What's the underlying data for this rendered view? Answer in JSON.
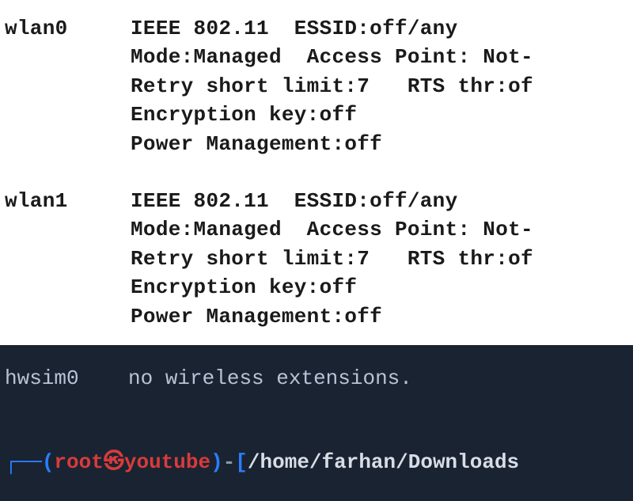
{
  "interfaces": [
    {
      "name": "wlan0",
      "lines": [
        "wlan0     IEEE 802.11  ESSID:off/any",
        "          Mode:Managed  Access Point: Not-",
        "          Retry short limit:7   RTS thr:of",
        "          Encryption key:off",
        "          Power Management:off"
      ]
    },
    {
      "name": "wlan1",
      "lines": [
        "wlan1     IEEE 802.11  ESSID:off/any",
        "          Mode:Managed  Access Point: Not-",
        "          Retry short limit:7   RTS thr:of",
        "          Encryption key:off",
        "          Power Management:off"
      ]
    }
  ],
  "dark_line": "hwsim0    no wireless extensions.",
  "prompt": {
    "box": "┌──",
    "paren_open": "(",
    "user": "root",
    "icon": "㉿",
    "host": "youtube",
    "paren_close": ")",
    "dash": "-",
    "bracket_open": "[",
    "path": "/home/farhan/Downloads"
  }
}
